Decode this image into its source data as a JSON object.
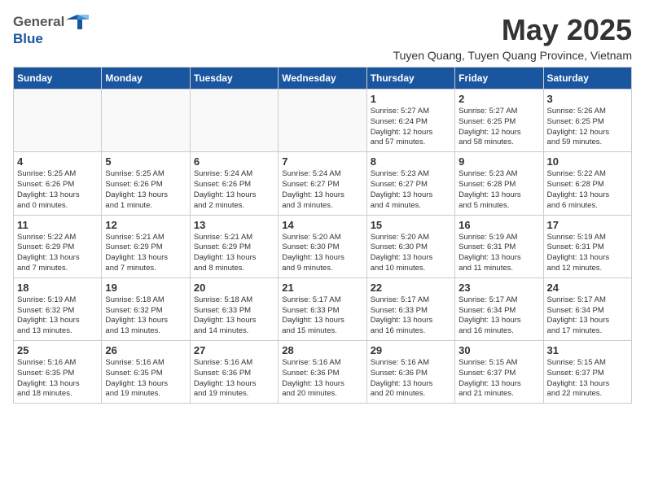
{
  "header": {
    "logo_general": "General",
    "logo_blue": "Blue",
    "month_year": "May 2025",
    "location": "Tuyen Quang, Tuyen Quang Province, Vietnam"
  },
  "weekdays": [
    "Sunday",
    "Monday",
    "Tuesday",
    "Wednesday",
    "Thursday",
    "Friday",
    "Saturday"
  ],
  "weeks": [
    [
      {
        "day": "",
        "info": ""
      },
      {
        "day": "",
        "info": ""
      },
      {
        "day": "",
        "info": ""
      },
      {
        "day": "",
        "info": ""
      },
      {
        "day": "1",
        "info": "Sunrise: 5:27 AM\nSunset: 6:24 PM\nDaylight: 12 hours\nand 57 minutes."
      },
      {
        "day": "2",
        "info": "Sunrise: 5:27 AM\nSunset: 6:25 PM\nDaylight: 12 hours\nand 58 minutes."
      },
      {
        "day": "3",
        "info": "Sunrise: 5:26 AM\nSunset: 6:25 PM\nDaylight: 12 hours\nand 59 minutes."
      }
    ],
    [
      {
        "day": "4",
        "info": "Sunrise: 5:25 AM\nSunset: 6:26 PM\nDaylight: 13 hours\nand 0 minutes."
      },
      {
        "day": "5",
        "info": "Sunrise: 5:25 AM\nSunset: 6:26 PM\nDaylight: 13 hours\nand 1 minute."
      },
      {
        "day": "6",
        "info": "Sunrise: 5:24 AM\nSunset: 6:26 PM\nDaylight: 13 hours\nand 2 minutes."
      },
      {
        "day": "7",
        "info": "Sunrise: 5:24 AM\nSunset: 6:27 PM\nDaylight: 13 hours\nand 3 minutes."
      },
      {
        "day": "8",
        "info": "Sunrise: 5:23 AM\nSunset: 6:27 PM\nDaylight: 13 hours\nand 4 minutes."
      },
      {
        "day": "9",
        "info": "Sunrise: 5:23 AM\nSunset: 6:28 PM\nDaylight: 13 hours\nand 5 minutes."
      },
      {
        "day": "10",
        "info": "Sunrise: 5:22 AM\nSunset: 6:28 PM\nDaylight: 13 hours\nand 6 minutes."
      }
    ],
    [
      {
        "day": "11",
        "info": "Sunrise: 5:22 AM\nSunset: 6:29 PM\nDaylight: 13 hours\nand 7 minutes."
      },
      {
        "day": "12",
        "info": "Sunrise: 5:21 AM\nSunset: 6:29 PM\nDaylight: 13 hours\nand 7 minutes."
      },
      {
        "day": "13",
        "info": "Sunrise: 5:21 AM\nSunset: 6:29 PM\nDaylight: 13 hours\nand 8 minutes."
      },
      {
        "day": "14",
        "info": "Sunrise: 5:20 AM\nSunset: 6:30 PM\nDaylight: 13 hours\nand 9 minutes."
      },
      {
        "day": "15",
        "info": "Sunrise: 5:20 AM\nSunset: 6:30 PM\nDaylight: 13 hours\nand 10 minutes."
      },
      {
        "day": "16",
        "info": "Sunrise: 5:19 AM\nSunset: 6:31 PM\nDaylight: 13 hours\nand 11 minutes."
      },
      {
        "day": "17",
        "info": "Sunrise: 5:19 AM\nSunset: 6:31 PM\nDaylight: 13 hours\nand 12 minutes."
      }
    ],
    [
      {
        "day": "18",
        "info": "Sunrise: 5:19 AM\nSunset: 6:32 PM\nDaylight: 13 hours\nand 13 minutes."
      },
      {
        "day": "19",
        "info": "Sunrise: 5:18 AM\nSunset: 6:32 PM\nDaylight: 13 hours\nand 13 minutes."
      },
      {
        "day": "20",
        "info": "Sunrise: 5:18 AM\nSunset: 6:33 PM\nDaylight: 13 hours\nand 14 minutes."
      },
      {
        "day": "21",
        "info": "Sunrise: 5:17 AM\nSunset: 6:33 PM\nDaylight: 13 hours\nand 15 minutes."
      },
      {
        "day": "22",
        "info": "Sunrise: 5:17 AM\nSunset: 6:33 PM\nDaylight: 13 hours\nand 16 minutes."
      },
      {
        "day": "23",
        "info": "Sunrise: 5:17 AM\nSunset: 6:34 PM\nDaylight: 13 hours\nand 16 minutes."
      },
      {
        "day": "24",
        "info": "Sunrise: 5:17 AM\nSunset: 6:34 PM\nDaylight: 13 hours\nand 17 minutes."
      }
    ],
    [
      {
        "day": "25",
        "info": "Sunrise: 5:16 AM\nSunset: 6:35 PM\nDaylight: 13 hours\nand 18 minutes."
      },
      {
        "day": "26",
        "info": "Sunrise: 5:16 AM\nSunset: 6:35 PM\nDaylight: 13 hours\nand 19 minutes."
      },
      {
        "day": "27",
        "info": "Sunrise: 5:16 AM\nSunset: 6:36 PM\nDaylight: 13 hours\nand 19 minutes."
      },
      {
        "day": "28",
        "info": "Sunrise: 5:16 AM\nSunset: 6:36 PM\nDaylight: 13 hours\nand 20 minutes."
      },
      {
        "day": "29",
        "info": "Sunrise: 5:16 AM\nSunset: 6:36 PM\nDaylight: 13 hours\nand 20 minutes."
      },
      {
        "day": "30",
        "info": "Sunrise: 5:15 AM\nSunset: 6:37 PM\nDaylight: 13 hours\nand 21 minutes."
      },
      {
        "day": "31",
        "info": "Sunrise: 5:15 AM\nSunset: 6:37 PM\nDaylight: 13 hours\nand 22 minutes."
      }
    ]
  ]
}
